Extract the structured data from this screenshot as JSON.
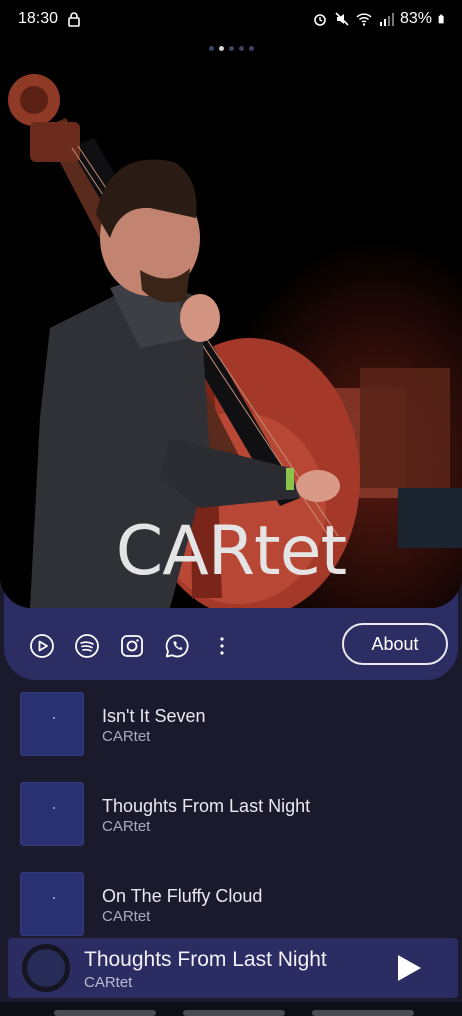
{
  "status_bar": {
    "time": "18:30",
    "battery": "83%"
  },
  "hero": {
    "band_name": "CARtet",
    "page_indicator": {
      "count": 5,
      "active": 2
    }
  },
  "actions": {
    "icons": [
      "youtube-icon",
      "spotify-icon",
      "instagram-icon",
      "whatsapp-icon",
      "more-vert-icon"
    ],
    "about_label": "About"
  },
  "tracks": [
    {
      "title": "Isn't It Seven",
      "artist": "CARtet"
    },
    {
      "title": "Thoughts From Last Night",
      "artist": "CARtet"
    },
    {
      "title": "On The Fluffy Cloud",
      "artist": "CARtet"
    }
  ],
  "mini_player": {
    "title": "Thoughts From Last Night",
    "artist": "CARtet",
    "play_icon": "play-icon"
  },
  "colors": {
    "background": "#1b1a2c",
    "panel": "#2c2d63",
    "accent": "#e8e8ee"
  }
}
